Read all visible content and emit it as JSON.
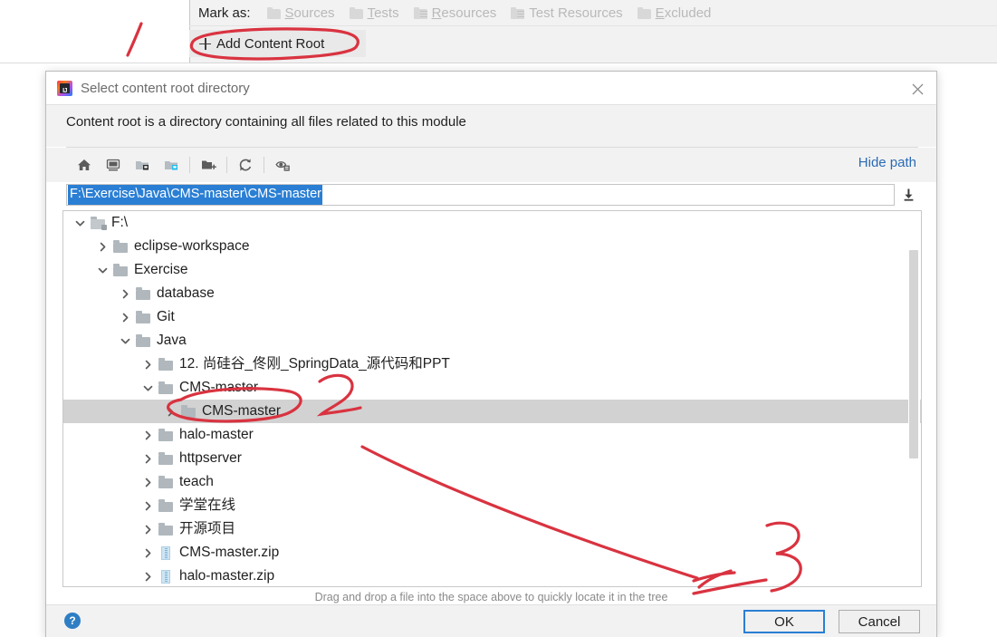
{
  "ide": {
    "mark_as_label": "Mark as:",
    "mark_as_items": [
      {
        "label": "Sources",
        "mnemonic": "S",
        "rest": "ources",
        "icon": "folder-icon"
      },
      {
        "label": "Tests",
        "mnemonic": "T",
        "rest": "ests",
        "icon": "folder-icon"
      },
      {
        "label": "Resources",
        "mnemonic": "R",
        "rest": "esources",
        "icon": "resources-folder-icon"
      },
      {
        "label": "Test Resources",
        "mnemonic": "",
        "rest": "Test Resources",
        "icon": "test-resources-folder-icon"
      },
      {
        "label": "Excluded",
        "mnemonic": "E",
        "rest": "xcluded",
        "icon": "folder-icon"
      }
    ],
    "add_content_root_label": "Add Content Root",
    "add_content_root_icon": "plus-icon"
  },
  "dialog": {
    "app_icon": "intellij-idea-logo-icon",
    "title": "Select content root directory",
    "close_icon": "close-icon",
    "description": "Content root is a directory containing all files related to this module",
    "hide_path_label": "Hide path",
    "toolbar": [
      {
        "name": "home-icon",
        "tooltip": "Home"
      },
      {
        "name": "desktop-icon",
        "tooltip": "Desktop"
      },
      {
        "name": "project-folder-icon",
        "tooltip": "Project"
      },
      {
        "name": "module-folder-icon",
        "tooltip": "Module"
      },
      {
        "name": "new-folder-icon",
        "tooltip": "New Folder"
      },
      {
        "name": "refresh-icon",
        "tooltip": "Refresh"
      },
      {
        "name": "show-hidden-files-icon",
        "tooltip": "Show Hidden Files"
      }
    ],
    "path": {
      "value": "F:\\Exercise\\Java\\CMS-master\\CMS-master",
      "selected": true,
      "dropdown_icon": "download-arrow-icon"
    },
    "tree": [
      {
        "label": "F:\\",
        "depth": 0,
        "state": "expanded",
        "icon": "drive-folder-icon",
        "selected": false
      },
      {
        "label": "eclipse-workspace",
        "depth": 1,
        "state": "collapsed",
        "icon": "folder-icon",
        "selected": false
      },
      {
        "label": "Exercise",
        "depth": 1,
        "state": "expanded",
        "icon": "folder-icon",
        "selected": false
      },
      {
        "label": "database",
        "depth": 2,
        "state": "collapsed",
        "icon": "folder-icon",
        "selected": false
      },
      {
        "label": "Git",
        "depth": 2,
        "state": "collapsed",
        "icon": "folder-icon",
        "selected": false
      },
      {
        "label": "Java",
        "depth": 2,
        "state": "expanded",
        "icon": "folder-icon",
        "selected": false
      },
      {
        "label": "12. 尚硅谷_佟刚_SpringData_源代码和PPT",
        "depth": 3,
        "state": "collapsed",
        "icon": "folder-icon",
        "selected": false
      },
      {
        "label": "CMS-master",
        "depth": 3,
        "state": "expanded",
        "icon": "folder-icon",
        "selected": false
      },
      {
        "label": "CMS-master",
        "depth": 4,
        "state": "collapsed",
        "icon": "folder-icon",
        "selected": true
      },
      {
        "label": "halo-master",
        "depth": 3,
        "state": "collapsed",
        "icon": "folder-icon",
        "selected": false
      },
      {
        "label": "httpserver",
        "depth": 3,
        "state": "collapsed",
        "icon": "folder-icon",
        "selected": false
      },
      {
        "label": "teach",
        "depth": 3,
        "state": "collapsed",
        "icon": "folder-icon",
        "selected": false
      },
      {
        "label": "学堂在线",
        "depth": 3,
        "state": "collapsed",
        "icon": "folder-icon",
        "selected": false
      },
      {
        "label": "开源项目",
        "depth": 3,
        "state": "collapsed",
        "icon": "folder-icon",
        "selected": false
      },
      {
        "label": "CMS-master.zip",
        "depth": 3,
        "state": "collapsed",
        "icon": "zip-file-icon",
        "selected": false
      },
      {
        "label": "halo-master.zip",
        "depth": 3,
        "state": "collapsed",
        "icon": "zip-file-icon",
        "selected": false
      }
    ],
    "hint": "Drag and drop a file into the space above to quickly locate it in the tree",
    "help_icon": "help-question-icon",
    "help_label": "?",
    "ok_label": "OK",
    "cancel_label": "Cancel"
  },
  "annotations": [
    {
      "name": "annotation-stroke-1",
      "note": "red slash near Add Content Root"
    },
    {
      "name": "annotation-ellipse-add-content-root",
      "note": "red ellipse around Add Content Root"
    },
    {
      "name": "annotation-ellipse-cms-master",
      "note": "red ellipse around selected CMS-master row"
    },
    {
      "name": "annotation-digit-2",
      "note": "red handwritten 2"
    },
    {
      "name": "annotation-arrow",
      "note": "red arrow toward lower area"
    },
    {
      "name": "annotation-digit-3",
      "note": "red handwritten 3"
    }
  ],
  "colors": {
    "accent_blue": "#2a7fd4",
    "link_blue": "#2a6bb5",
    "selection_grey": "#d2d2d2",
    "annotation_red": "#d93340",
    "panel_grey": "#f2f2f2"
  }
}
